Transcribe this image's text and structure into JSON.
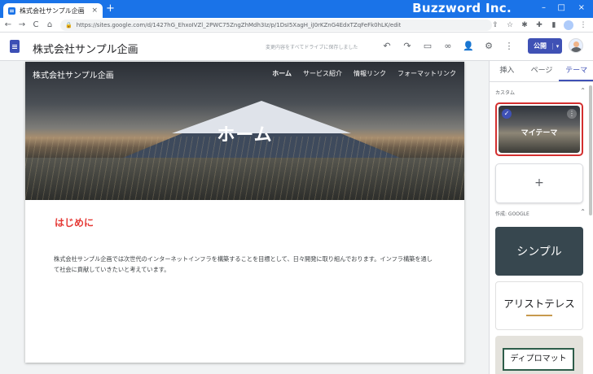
{
  "browser": {
    "tab_title": "株式会社サンプル企画",
    "tab_close": "×",
    "new_tab": "+",
    "brand": "Buzzword Inc.",
    "url": "https://sites.google.com/d/1427hG_EhxoIVZl_2PWC75ZngZhMdh3Iz/p/1DsI5XagH_iJ0rKZnG4EdxTZqFeFk0hLK/edit",
    "nav": {
      "back": "←",
      "forward": "→",
      "reload": "C",
      "home": "⌂"
    },
    "window_controls": {
      "minimize": "–",
      "maximize": "□",
      "close": "×"
    }
  },
  "sites_header": {
    "site_name": "株式会社サンプル企画",
    "saved_message": "変更内容をすべてドライブに保存しました",
    "publish_label": "公開",
    "publish_caret": "▾"
  },
  "site_page": {
    "site_title": "株式会社サンプル企画",
    "nav": [
      "ホーム",
      "サービス紹介",
      "情報リンク",
      "フォーマットリンク"
    ],
    "banner_title": "ホーム",
    "intro_heading": "はじめに",
    "intro_body": "株式会社サンプル企画では次世代のインターネットインフラを構築することを目標として、日々開発に取り組んでおります。インフラ構築を通して社会に貢献していきたいと考えています。"
  },
  "panel": {
    "tabs": [
      "挿入",
      "ページ",
      "テーマ"
    ],
    "active_tab": "テーマ",
    "custom_label": "カスタム",
    "my_theme_label": "マイテーマ",
    "add_label": "+",
    "google_label": "作成: GOOGLE",
    "caret": "⌃",
    "themes": [
      "シンプル",
      "アリストテレス",
      "ディプロマット"
    ]
  },
  "colors": {
    "chrome_blue": "#1a73e8",
    "publish": "#3f51b5",
    "accent_red": "#e53935",
    "selected_border": "#d32f2f"
  }
}
